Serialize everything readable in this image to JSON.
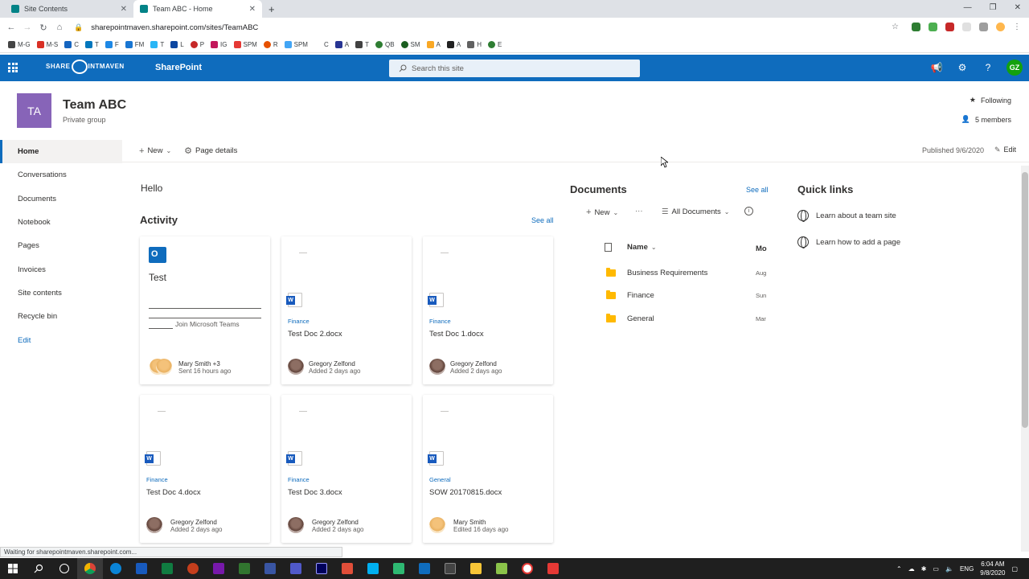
{
  "browser": {
    "tabs": [
      {
        "label": "Site Contents"
      },
      {
        "label": "Team ABC - Home"
      }
    ],
    "url": "sharepointmaven.sharepoint.com/sites/TeamABC",
    "bookmarks": [
      "M-G",
      "M-S",
      "C",
      "T",
      "F",
      "FM",
      "T",
      "L",
      "P",
      "IG",
      "SPM",
      "R",
      "SPM",
      "C",
      "A",
      "T",
      "QB",
      "SM",
      "A",
      "A",
      "H",
      "E"
    ],
    "status": "Waiting for sharepointmaven.sharepoint.com..."
  },
  "suite": {
    "logo_left": "SHARE",
    "logo_right": "INTMAVEN",
    "app": "SharePoint",
    "search_placeholder": "Search this site",
    "user_initials": "GZ",
    "brand_color": "#0f6cbd"
  },
  "site": {
    "initials": "TA",
    "title": "Team ABC",
    "subtitle": "Private group",
    "following": "Following",
    "members": "5 members"
  },
  "nav": {
    "items": [
      {
        "label": "Home"
      },
      {
        "label": "Conversations"
      },
      {
        "label": "Documents"
      },
      {
        "label": "Notebook"
      },
      {
        "label": "Pages"
      },
      {
        "label": "Invoices"
      },
      {
        "label": "Site contents"
      },
      {
        "label": "Recycle bin"
      }
    ],
    "edit": "Edit"
  },
  "command": {
    "new": "New",
    "page_details": "Page details",
    "published": "Published 9/6/2020",
    "edit": "Edit"
  },
  "main": {
    "hello": "Hello",
    "activity": {
      "title": "Activity",
      "see_all": "See all",
      "first": {
        "title": "Test",
        "join": "Join Microsoft Teams",
        "person": "Mary Smith +3",
        "when": "Sent 16 hours ago"
      },
      "cards": [
        {
          "lib": "Finance",
          "name": "Test Doc 2.docx",
          "person": "Gregory Zelfond",
          "when": "Added 2 days ago"
        },
        {
          "lib": "Finance",
          "name": "Test Doc 1.docx",
          "person": "Gregory Zelfond",
          "when": "Added 2 days ago"
        },
        {
          "lib": "Finance",
          "name": "Test Doc 4.docx",
          "person": "Gregory Zelfond",
          "when": "Added 2 days ago"
        },
        {
          "lib": "Finance",
          "name": "Test Doc 3.docx",
          "person": "Gregory Zelfond",
          "when": "Added 2 days ago"
        },
        {
          "lib": "General",
          "name": "SOW 20170815.docx",
          "person": "Mary Smith",
          "when": "Edited 16 days ago"
        }
      ]
    },
    "documents": {
      "title": "Documents",
      "see_all": "See all",
      "new": "New",
      "more": "···",
      "view": "All Documents",
      "col_name": "Name",
      "col_modified": "Mo",
      "rows": [
        {
          "name": "Business Requirements",
          "modified": "Aug"
        },
        {
          "name": "Finance",
          "modified": "Sun"
        },
        {
          "name": "General",
          "modified": "Mar"
        }
      ]
    },
    "quick_links": {
      "title": "Quick links",
      "items": [
        {
          "label": "Learn about a team site"
        },
        {
          "label": "Learn how to add a page"
        }
      ]
    }
  },
  "taskbar": {
    "lang": "ENG",
    "time": "6:04 AM",
    "date": "9/8/2020"
  }
}
